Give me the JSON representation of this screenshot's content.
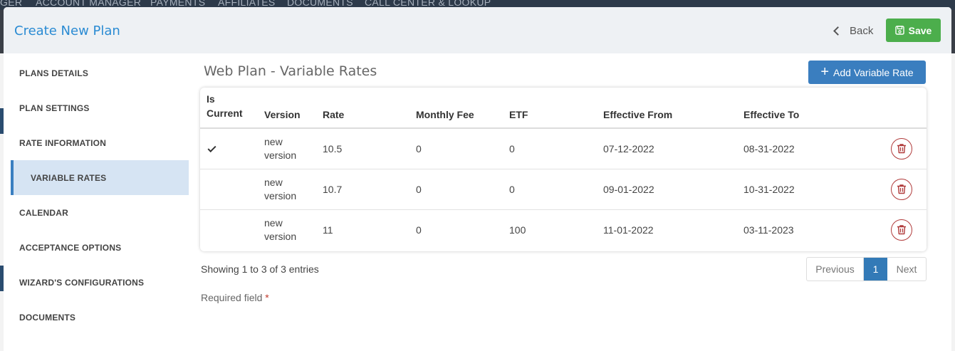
{
  "background_nav": [
    "GER",
    "ACCOUNT MANAGER",
    "PAYMENTS",
    "AFFILIATES",
    "DOCUMENTS",
    "CALL CENTER & LOOKUP"
  ],
  "header": {
    "title": "Create New Plan",
    "back_label": "Back",
    "save_label": "Save"
  },
  "sidebar": {
    "items": [
      {
        "label": "PLANS DETAILS"
      },
      {
        "label": "PLAN SETTINGS"
      },
      {
        "label": "RATE INFORMATION"
      },
      {
        "label": "VARIABLE RATES",
        "active": true
      },
      {
        "label": "CALENDAR"
      },
      {
        "label": "ACCEPTANCE OPTIONS"
      },
      {
        "label": "WIZARD'S CONFIGURATIONS"
      },
      {
        "label": "DOCUMENTS"
      }
    ]
  },
  "main": {
    "title": "Web Plan - Variable Rates",
    "add_button_label": "Add Variable Rate",
    "table": {
      "columns": [
        "Is Current",
        "Version",
        "Rate",
        "Monthly Fee",
        "ETF",
        "Effective From",
        "Effective To",
        ""
      ],
      "rows": [
        {
          "is_current": true,
          "version": "new version",
          "rate": "10.5",
          "monthly_fee": "0",
          "etf": "0",
          "effective_from": "07-12-2022",
          "effective_to": "08-31-2022"
        },
        {
          "is_current": false,
          "version": "new version",
          "rate": "10.7",
          "monthly_fee": "0",
          "etf": "0",
          "effective_from": "09-01-2022",
          "effective_to": "10-31-2022"
        },
        {
          "is_current": false,
          "version": "new version",
          "rate": "11",
          "monthly_fee": "0",
          "etf": "100",
          "effective_from": "11-01-2022",
          "effective_to": "03-11-2023"
        }
      ]
    },
    "showing_text": "Showing 1 to 3 of 3 entries",
    "pagination": {
      "previous": "Previous",
      "current": "1",
      "next": "Next"
    },
    "required_text": "Required field",
    "required_star": "*"
  },
  "colors": {
    "title_blue": "#2a8bd3",
    "save_green": "#4cae4c",
    "add_blue": "#3a7ebf",
    "active_bg": "#d6e4f3",
    "delete_red": "#b03a3a"
  },
  "icons": {
    "back": "chevron-left-icon",
    "save": "floppy-disk-icon",
    "add": "plus-icon",
    "current": "checkmark-icon",
    "delete": "trash-icon"
  }
}
